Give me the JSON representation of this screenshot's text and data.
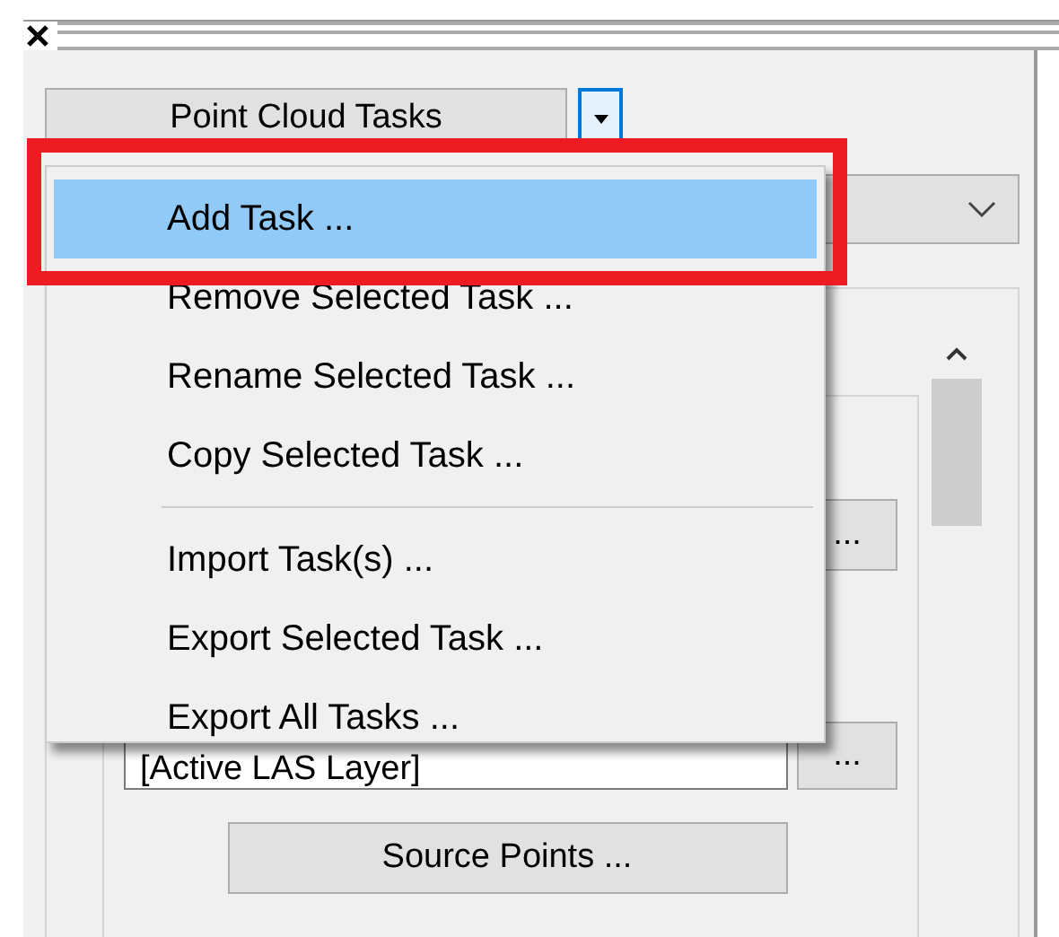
{
  "panel": {
    "task_button": "Point Cloud Tasks",
    "browse_buttons": [
      "...",
      "..."
    ],
    "layer_field": {
      "value": "[Active LAS Layer]"
    },
    "source_button": "Source Points ..."
  },
  "menu": {
    "groups": [
      [
        {
          "label": "Add Task ...",
          "selected": true
        },
        {
          "label": "Remove Selected Task ...",
          "selected": false
        },
        {
          "label": "Rename Selected Task ...",
          "selected": false
        },
        {
          "label": "Copy Selected Task ...",
          "selected": false
        }
      ],
      [
        {
          "label": "Import Task(s) ...",
          "selected": false
        },
        {
          "label": "Export Selected Task ...",
          "selected": false
        },
        {
          "label": "Export All Tasks ...",
          "selected": false
        }
      ]
    ]
  }
}
